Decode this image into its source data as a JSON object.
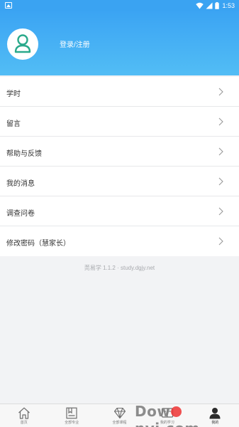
{
  "status_bar": {
    "time": "1:53"
  },
  "header": {
    "login_label": "登录/注册"
  },
  "menu": {
    "items": [
      {
        "label": "学时"
      },
      {
        "label": "留言"
      },
      {
        "label": "帮助与反馈"
      },
      {
        "label": "我的消息"
      },
      {
        "label": "调查问卷"
      },
      {
        "label": "修改密码（慧家长）"
      }
    ]
  },
  "version": "莞易学 1.1.2 · study.dgjy.net",
  "bottom_nav": {
    "items": [
      {
        "label": "首页",
        "icon": "home-icon"
      },
      {
        "label": "全部专业",
        "icon": "book-icon"
      },
      {
        "label": "全部课程",
        "icon": "diamond-icon"
      },
      {
        "label": "我的学习",
        "icon": "study-icon"
      },
      {
        "label": "我的",
        "icon": "user-icon"
      }
    ],
    "active": "我的"
  },
  "watermark": {
    "text_before": "Dow",
    "text_after": "nyi.com"
  },
  "colors": {
    "accent": "#3aa3f2",
    "avatar_icon": "#2aa98b"
  }
}
